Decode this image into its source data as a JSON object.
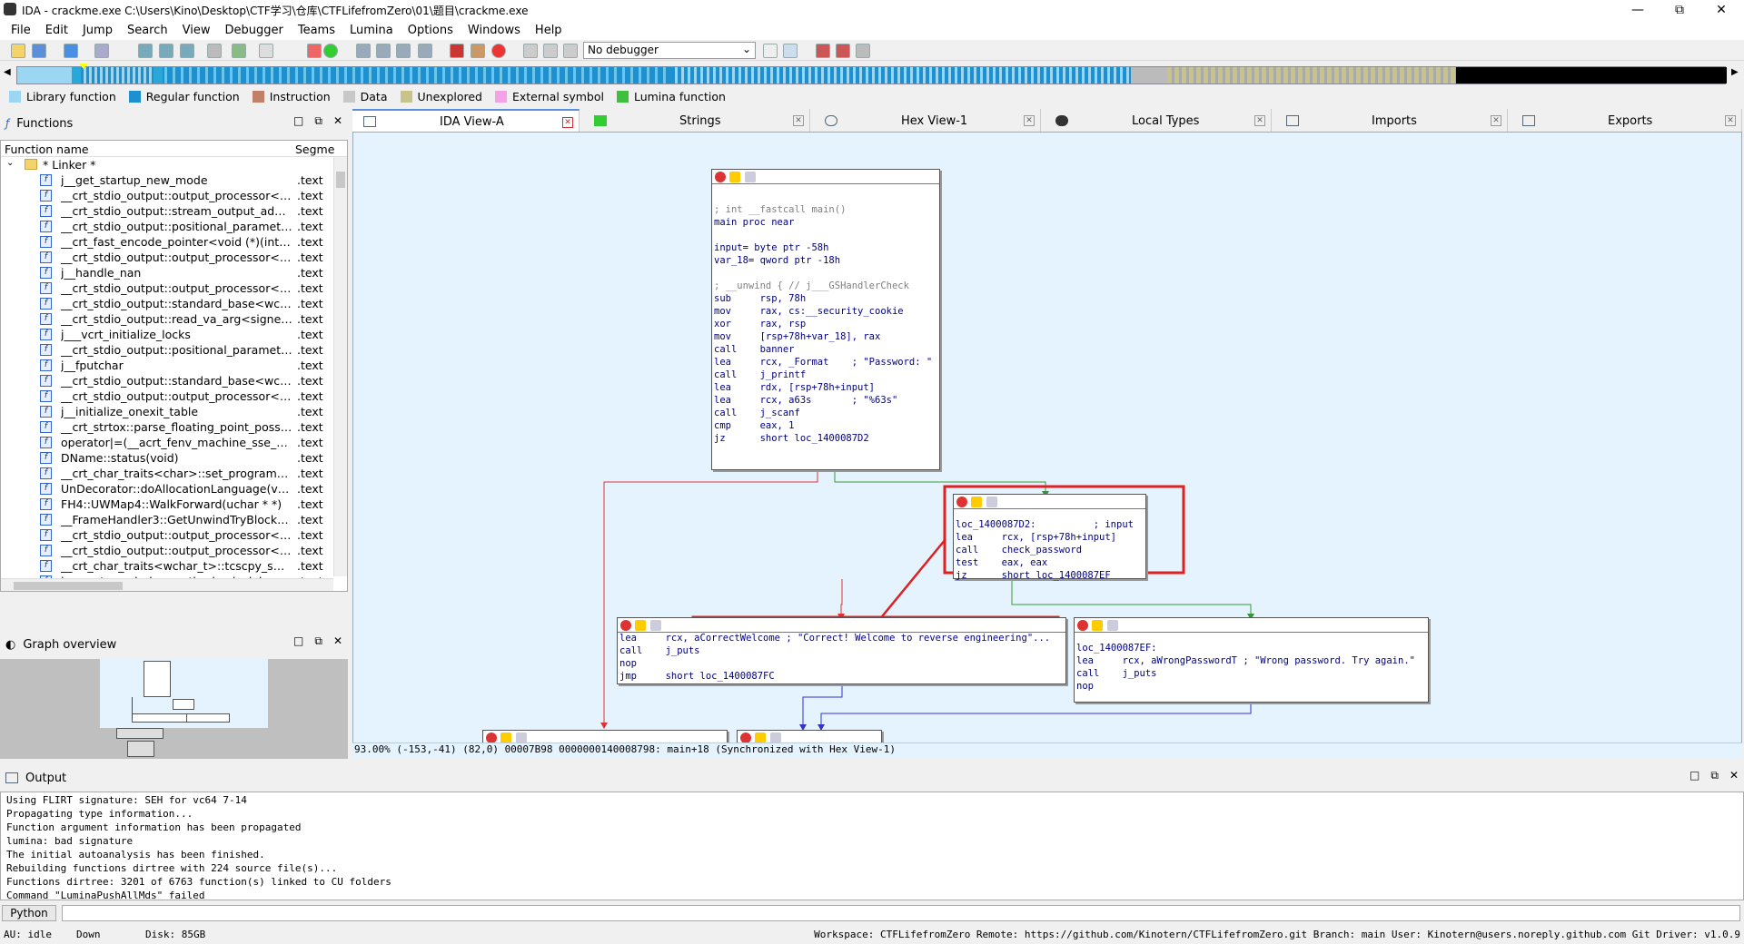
{
  "window": {
    "title": "IDA - crackme.exe C:\\Users\\Kino\\Desktop\\CTF学习\\仓库\\CTFLifefromZero\\01\\题目\\crackme.exe"
  },
  "menu": [
    "File",
    "Edit",
    "Jump",
    "Search",
    "View",
    "Debugger",
    "Teams",
    "Lumina",
    "Options",
    "Windows",
    "Help"
  ],
  "toolbar": {
    "debugger_select": "No debugger"
  },
  "legend": [
    {
      "label": "Library function",
      "color": "#9bd7f2"
    },
    {
      "label": "Regular function",
      "color": "#1e90d0"
    },
    {
      "label": "Instruction",
      "color": "#c0806a"
    },
    {
      "label": "Data",
      "color": "#c8c8c8"
    },
    {
      "label": "Unexplored",
      "color": "#c7c38a"
    },
    {
      "label": "External symbol",
      "color": "#f3a2e6"
    },
    {
      "label": "Lumina function",
      "color": "#3ec03e"
    }
  ],
  "functions_panel": {
    "title": "Functions",
    "col_name": "Function name",
    "col_seg": "Segme",
    "folder": "* Linker *",
    "rows": [
      {
        "name": "j__get_startup_new_mode",
        "seg": ".text"
      },
      {
        "name": "__crt_stdio_output::output_processor<wch...",
        "seg": ".text"
      },
      {
        "name": "__crt_stdio_output::stream_output_adapte...",
        "seg": ".text"
      },
      {
        "name": "__crt_stdio_output::positional_parameter_...",
        "seg": ".text"
      },
      {
        "name": "__crt_fast_encode_pointer<void (*)(int)>(v...",
        "seg": ".text"
      },
      {
        "name": "__crt_stdio_output::output_processor<cha...",
        "seg": ".text"
      },
      {
        "name": "j__handle_nan",
        "seg": ".text"
      },
      {
        "name": "__crt_stdio_output::output_processor<cha...",
        "seg": ".text"
      },
      {
        "name": "__crt_stdio_output::standard_base<wchar_...",
        "seg": ".text"
      },
      {
        "name": "__crt_stdio_output::read_va_arg<signed c...",
        "seg": ".text"
      },
      {
        "name": "j___vcrt_initialize_locks",
        "seg": ".text"
      },
      {
        "name": "__crt_stdio_output::positional_parameter_...",
        "seg": ".text"
      },
      {
        "name": "j__fputchar",
        "seg": ".text"
      },
      {
        "name": "__crt_stdio_output::standard_base<wchar_...",
        "seg": ".text"
      },
      {
        "name": "__crt_stdio_output::output_processor<wch...",
        "seg": ".text"
      },
      {
        "name": "j__initialize_onexit_table",
        "seg": ".text"
      },
      {
        "name": "__crt_strtox::parse_floating_point_possible...",
        "seg": ".text"
      },
      {
        "name": "operator|=(__acrt_fenv_machine_sse_statu...",
        "seg": ".text"
      },
      {
        "name": "DName::status(void)",
        "seg": ".text"
      },
      {
        "name": "__crt_char_traits<char>::set_program_na...",
        "seg": ".text"
      },
      {
        "name": "UnDecorator::doAllocationLanguage(void)",
        "seg": ".text"
      },
      {
        "name": "FH4::UWMap4::WalkForward(uchar * *)",
        "seg": ".text"
      },
      {
        "name": "__FrameHandler3::GetUnwindTryBlock(uns...",
        "seg": ".text"
      },
      {
        "name": "__crt_stdio_output::output_processor<cha...",
        "seg": ".text"
      },
      {
        "name": "__crt_stdio_output::output_processor<wch...",
        "seg": ".text"
      },
      {
        "name": "__crt_char_traits<wchar_t>::tcscpy_s<wcha...",
        "seg": ".text"
      },
      {
        "name": "j___castguard_slow_path_check_debugbre...",
        "seg": ".text"
      }
    ]
  },
  "overview_panel": {
    "title": "Graph overview"
  },
  "tabs": [
    {
      "label": "IDA View-A"
    },
    {
      "label": "Strings"
    },
    {
      "label": "Hex View-1"
    },
    {
      "label": "Local Types"
    },
    {
      "label": "Imports"
    },
    {
      "label": "Exports"
    }
  ],
  "graph": {
    "node_main": [
      "; int __fastcall main()",
      "main proc near",
      "",
      "input= byte ptr -58h",
      "var_18= qword ptr -18h",
      "",
      "; __unwind { // j___GSHandlerCheck",
      "sub     rsp, 78h",
      "mov     rax, cs:__security_cookie",
      "xor     rax, rsp",
      "mov     [rsp+78h+var_18], rax",
      "call    banner",
      "lea     rcx, _Format    ; \"Password: \"",
      "call    j_printf",
      "lea     rdx, [rsp+78h+input]",
      "lea     rcx, a63s       ; \"%63s\"",
      "call    j_scanf",
      "cmp     eax, 1",
      "jz      short loc_1400087D2"
    ],
    "node_check": [
      "loc_1400087D2:          ; input",
      "lea     rcx, [rsp+78h+input]",
      "call    check_password",
      "test    eax, eax",
      "jz      short loc_1400087EF"
    ],
    "node_correct": [
      "lea     rcx, aCorrectWelcome ; \"Correct! Welcome to reverse engineering\"...",
      "call    j_puts",
      "nop",
      "jmp     short loc_1400087FC"
    ],
    "node_wrong": [
      "loc_1400087EF:",
      "lea     rcx, aWrongPasswordT ; \"Wrong password. Try again.\"",
      "call    j_puts",
      "nop"
    ],
    "status": "93.00% (-153,-41) (82,0) 00007B98 0000000140008798: main+18 (Synchronized with Hex View-1)"
  },
  "output_panel": {
    "title": "Output",
    "lines": [
      "Using FLIRT signature: SEH for vc64 7-14",
      "Propagating type information...",
      "Function argument information has been propagated",
      "lumina: bad signature",
      "The initial autoanalysis has been finished.",
      "Rebuilding functions dirtree with 224 source file(s)...",
      "Functions dirtree: 3201 of 6763 function(s) linked to CU folders",
      "Command \"LuminaPushAllMds\" failed"
    ]
  },
  "python_button": "Python",
  "statusbar": {
    "au": "AU:  idle",
    "down": "Down",
    "disk": "Disk: 85GB",
    "right": "Workspace: CTFLifefromZero Remote: https://github.com/Kinotern/CTFLifefromZero.git Branch: main User: Kinotern@users.noreply.github.com Git Driver: v1.0.9"
  }
}
